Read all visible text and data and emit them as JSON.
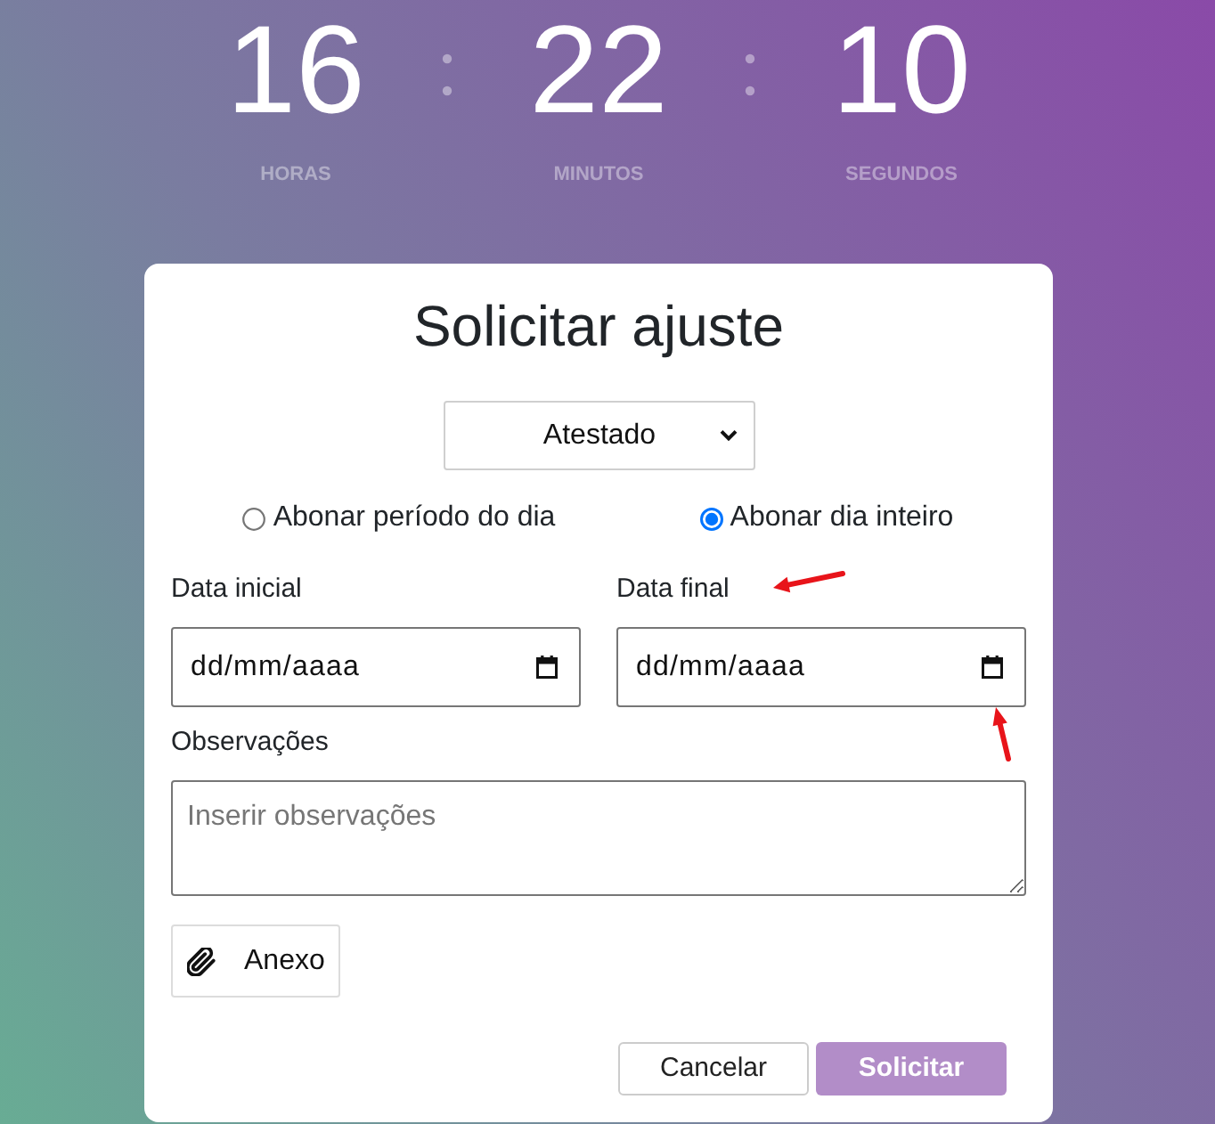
{
  "countdown": [
    {
      "value": "16",
      "unit": "HORAS"
    },
    {
      "value": "22",
      "unit": "MINUTOS"
    },
    {
      "value": "10",
      "unit": "SEGUNDOS"
    }
  ],
  "dialog": {
    "title": "Solicitar ajuste",
    "type_select": {
      "value": "Atestado"
    },
    "options": [
      {
        "label": "Abonar período do dia",
        "selected": false
      },
      {
        "label": "Abonar dia inteiro",
        "selected": true
      }
    ],
    "date_fields": [
      {
        "label": "Data inicial",
        "placeholder": "dd/mm/aaaa"
      },
      {
        "label": "Data final",
        "placeholder": "dd/mm/aaaa"
      }
    ],
    "notes": {
      "label": "Observações",
      "placeholder": "Inserir observações"
    },
    "attach_button": {
      "label": "Anexo"
    },
    "buttons": [
      {
        "label": "Cancelar",
        "kind": "secondary"
      },
      {
        "label": "Solicitar",
        "kind": "primary"
      }
    ]
  }
}
